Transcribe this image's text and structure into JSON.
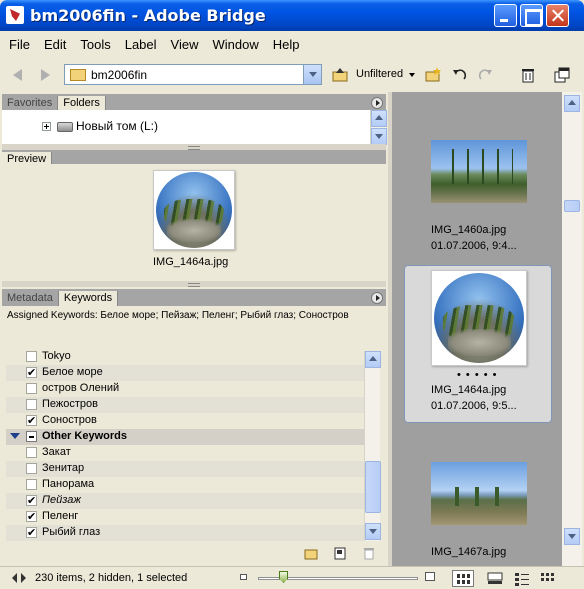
{
  "window": {
    "title": "bm2006fin - Adobe Bridge"
  },
  "menu": [
    "File",
    "Edit",
    "Tools",
    "Label",
    "View",
    "Window",
    "Help"
  ],
  "toolbar": {
    "path": "bm2006fin",
    "filter_label": "Unfiltered"
  },
  "top_panel": {
    "tabs": [
      "Favorites",
      "Folders"
    ],
    "active_tab": "Folders",
    "tree": [
      {
        "label": "Новый том (L:)"
      }
    ]
  },
  "preview_panel": {
    "tab": "Preview",
    "filename": "IMG_1464a.jpg"
  },
  "meta_panel": {
    "tabs": [
      "Metadata",
      "Keywords"
    ],
    "active_tab": "Keywords",
    "assigned": "Assigned Keywords: Белое море; Пейзаж; Пеленг; Рыбий глаз; Соностров",
    "keywords": [
      {
        "label": "Tokyo",
        "checked": false
      },
      {
        "label": "Белое море",
        "checked": true
      },
      {
        "label": "остров Олений",
        "checked": false
      },
      {
        "label": "Пежостров",
        "checked": false
      },
      {
        "label": "Соностров",
        "checked": true
      },
      {
        "label": "Other Keywords",
        "category": true
      },
      {
        "label": "Закат",
        "checked": false
      },
      {
        "label": "Зенитар",
        "checked": false
      },
      {
        "label": "Панорама",
        "checked": false
      },
      {
        "label": "Пейзаж",
        "checked": true,
        "italic": true
      },
      {
        "label": "Пеленг",
        "checked": true
      },
      {
        "label": "Рыбий глаз",
        "checked": true
      }
    ]
  },
  "content": {
    "items": [
      {
        "name": "IMG_1460a.jpg",
        "date": "01.07.2006, 9:4...",
        "selected": false,
        "kind": "landscape"
      },
      {
        "name": "IMG_1464a.jpg",
        "date": "01.07.2006, 9:5...",
        "selected": true,
        "kind": "fisheye",
        "rating": "• • • • •"
      },
      {
        "name": "IMG_1467a.jpg",
        "date": "",
        "selected": false,
        "kind": "sea"
      }
    ]
  },
  "status": {
    "text": "230 items, 2 hidden, 1 selected"
  },
  "icons": [
    "back-arrow-icon",
    "forward-arrow-icon",
    "folder-icon",
    "go-up-icon",
    "new-folder-icon",
    "rotate-left-icon",
    "rotate-right-icon",
    "trash-icon",
    "compact-mode-icon"
  ]
}
